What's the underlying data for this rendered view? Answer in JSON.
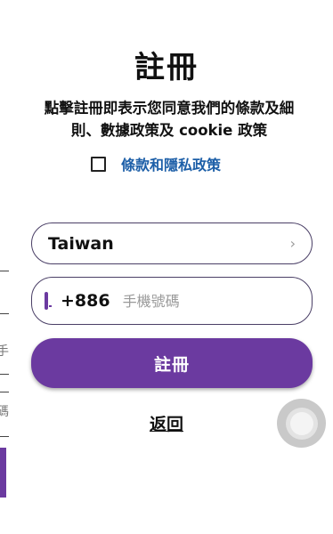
{
  "header": {
    "title": "註冊"
  },
  "notice": {
    "text": "點擊註冊即表示您同意我們的條款及細則、數據政策及 cookie 政策"
  },
  "terms": {
    "link_label": "條款和隱私政策",
    "checked": false
  },
  "country": {
    "value": "Taiwan",
    "chevron_icon": "chevron-right-icon"
  },
  "phone": {
    "dial_code": "+886",
    "placeholder": "手機號碼",
    "value": "",
    "icon": "mobile-phone-icon"
  },
  "actions": {
    "register_label": "註冊",
    "back_label": "返回"
  },
  "background_page": {
    "glyph_1": "手",
    "glyph_2": "碼"
  },
  "colors": {
    "accent": "#6b3aa0",
    "link": "#1d5fa8",
    "border": "#4a3f66"
  }
}
